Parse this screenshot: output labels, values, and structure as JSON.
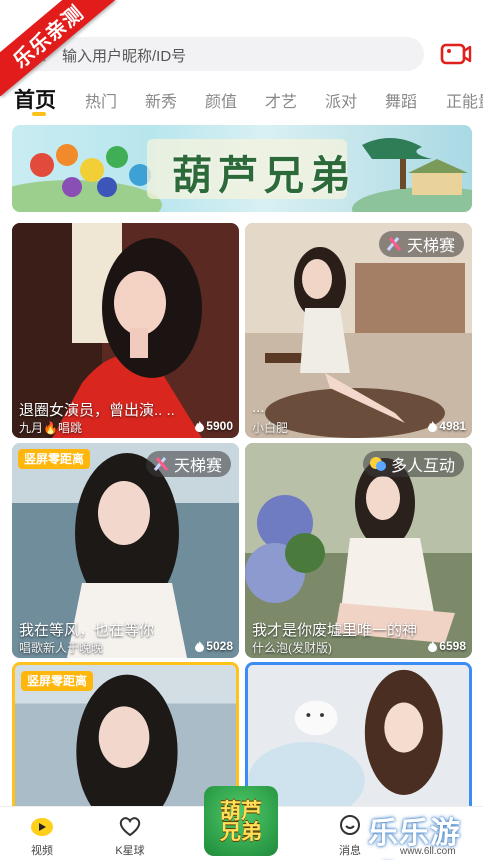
{
  "corner_badge": "乐乐亲测",
  "search": {
    "placeholder": "输入用户昵称/ID号"
  },
  "tabs": [
    "首页",
    "热门",
    "新秀",
    "颜值",
    "才艺",
    "派对",
    "舞蹈",
    "正能量"
  ],
  "active_tab": "首页",
  "banner": {
    "title": "葫芦兄弟"
  },
  "cards": [
    {
      "title": "退圈女演员，曾出演.. ..",
      "subtitle": "九月🔥唱跳",
      "heat": "5900",
      "badge": "",
      "tag": ""
    },
    {
      "title": "...",
      "subtitle": "小白肥",
      "heat": "4981",
      "badge": "天梯赛",
      "tag": ""
    },
    {
      "title": "我在等风，也在等你",
      "subtitle": "唱歌新人于晚晚",
      "heat": "5028",
      "badge": "天梯赛",
      "tag": "竖屏零距离"
    },
    {
      "title": "我才是你废墟里唯一的神",
      "subtitle": "什么泡(发财版)",
      "heat": "6598",
      "badge": "多人互动",
      "tag": ""
    },
    {
      "title": "",
      "subtitle": "",
      "heat": "",
      "badge": "",
      "tag": "竖屏零距离"
    },
    {
      "title": "",
      "subtitle": "",
      "heat": "",
      "badge": "",
      "tag": ""
    }
  ],
  "nav": {
    "video": "视频",
    "planet": "K星球",
    "center": "葫芦兄弟",
    "messages": "消息"
  },
  "watermark": {
    "brand": "乐乐游戏",
    "url": "www.6ll.com"
  },
  "colors": {
    "accent": "#ffc21a",
    "tag": "#ffb60d",
    "blue_frame": "#3b8cf3",
    "badge_red": "#e21b1b"
  }
}
